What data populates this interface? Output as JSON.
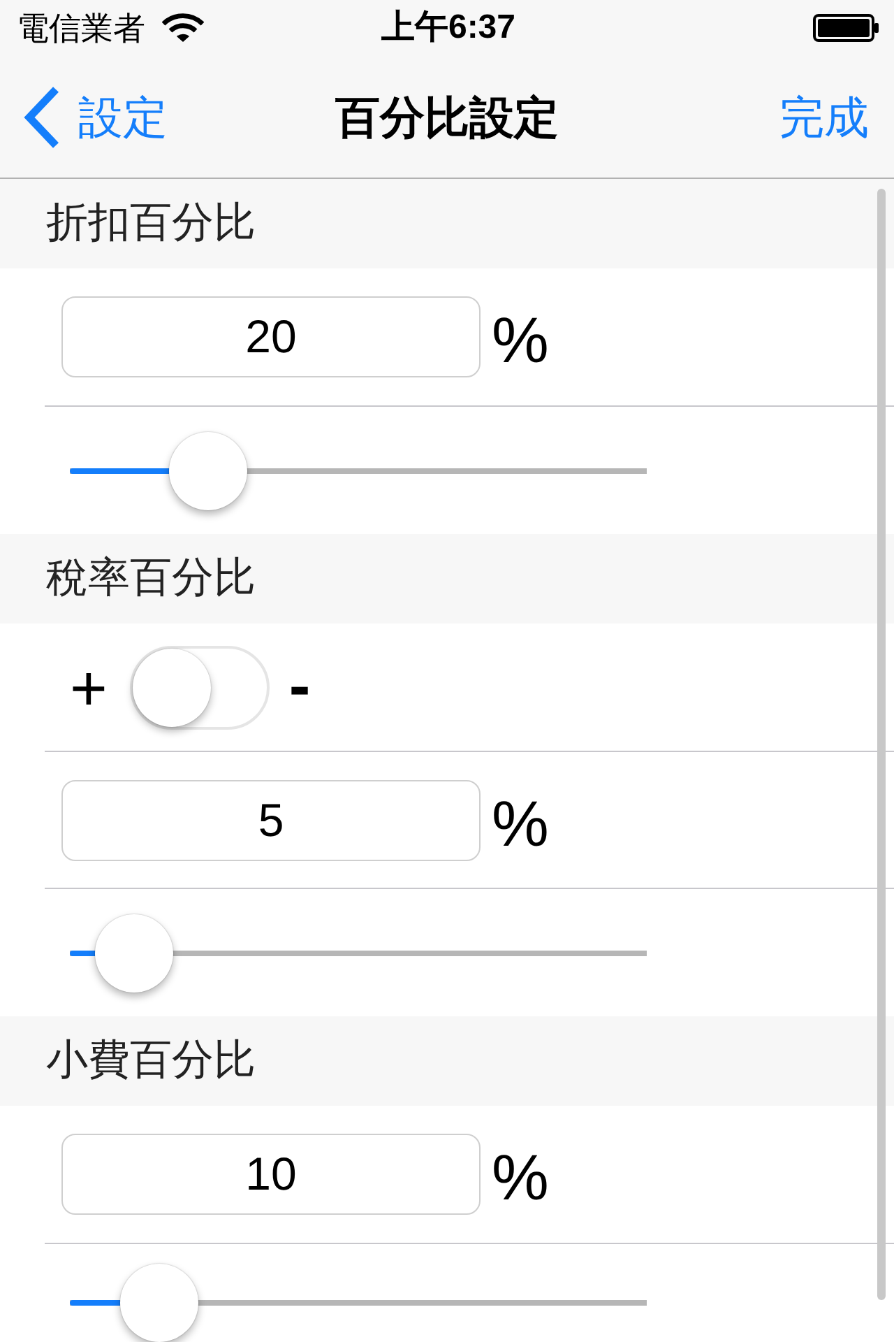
{
  "status_bar": {
    "carrier": "電信業者",
    "time": "上午6:37"
  },
  "nav_bar": {
    "back_label": "設定",
    "title": "百分比設定",
    "done_label": "完成"
  },
  "sections": [
    {
      "header": "折扣百分比",
      "rows": [
        {
          "kind": "field",
          "value": "20",
          "unit": "%"
        },
        {
          "kind": "slider",
          "level": 0.2
        }
      ]
    },
    {
      "header": "稅率百分比",
      "rows": [
        {
          "kind": "toggle",
          "left_label": "+",
          "right_label": "-",
          "on": false
        },
        {
          "kind": "field",
          "value": "5",
          "unit": "%"
        },
        {
          "kind": "slider",
          "level": 0.05
        }
      ]
    },
    {
      "header": "小費百分比",
      "rows": [
        {
          "kind": "field",
          "value": "10",
          "unit": "%"
        },
        {
          "kind": "slider",
          "level": 0.1
        }
      ]
    }
  ]
}
